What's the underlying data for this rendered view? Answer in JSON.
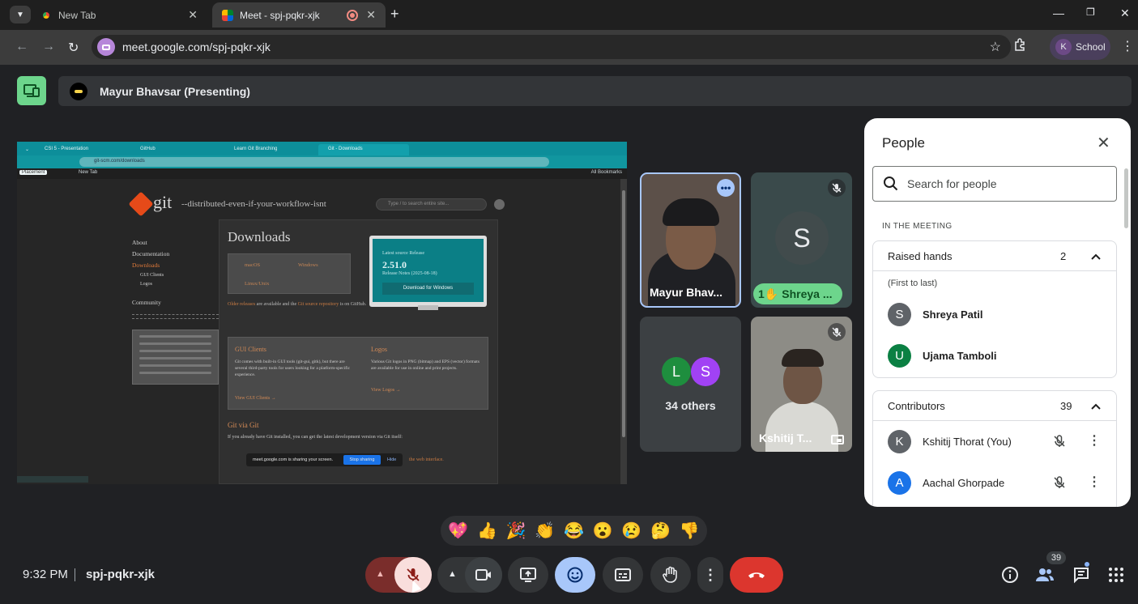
{
  "browser": {
    "tabs": [
      {
        "label": "New Tab",
        "active": false
      },
      {
        "label": "Meet - spj-pqkr-xjk",
        "active": true,
        "recording": true
      }
    ],
    "url": "meet.google.com/spj-pqkr-xjk",
    "profile": {
      "initial": "K",
      "label": "School"
    }
  },
  "meet": {
    "presenter_label": "Mayur Bhavsar (Presenting)",
    "time": "9:32 PM",
    "meeting_code": "spj-pqkr-xjk",
    "participant_count": "39",
    "colors": {
      "accent": "#a8c7fa",
      "end_call": "#dc362e",
      "hand_raise": "#6dd58c"
    }
  },
  "shared_screen": {
    "tabs": [
      "CSI 5 - Presentation",
      "GitHub",
      "Learn Git Branching",
      "Git - Downloads"
    ],
    "url": "git-scm.com/downloads",
    "bookmarks": {
      "first": "Placement",
      "new_tab": "New Tab",
      "all": "All Bookmarks"
    },
    "site": {
      "logo": "git",
      "tagline": "--distributed-even-if-your-workflow-isnt",
      "search_placeholder": "Type / to search entire site...",
      "nav": [
        "About",
        "Documentation",
        "Downloads",
        "GUI Clients",
        "Logos",
        "Community"
      ],
      "title": "Downloads",
      "os": [
        "macOS",
        "Windows",
        "Linux/Unix"
      ],
      "latest_label": "Latest source Release",
      "version": "2.51.0",
      "release_notes": "Release Notes (2025-08-18)",
      "download_button": "Download for Windows",
      "older_note_1": "Older releases",
      "older_note_2": " are available and the ",
      "older_note_3": "Git source repository",
      "older_note_4": " is on GitHub.",
      "gui_title": "GUI Clients",
      "gui_text": "Git comes with built-in GUI tools (git-gui, gitk), but there are several third-party tools for users looking for a platform-specific experience.",
      "gui_link": "View GUI Clients →",
      "logos_title": "Logos",
      "logos_text": "Various Git logos in PNG (bitmap) and EPS (vector) formats are available for use in online and print projects.",
      "logos_link": "View Logos →",
      "via_git_title": "Git via Git",
      "via_git_text": "If you already have Git installed, you can get the latest development version via Git itself:",
      "web_interface": "the web interface."
    },
    "share_bar": {
      "text": "meet.google.com is sharing your screen.",
      "stop": "Stop sharing",
      "hide": "Hide"
    }
  },
  "tiles": [
    {
      "name": "Mayur Bhav..."
    },
    {
      "name": "Shreya ...",
      "initial": "S",
      "hand_number": "1"
    },
    {
      "label": "34 others",
      "avatars": [
        {
          "initial": "L",
          "color": "#1e8e3e"
        },
        {
          "initial": "S",
          "color": "#a142f4"
        }
      ]
    },
    {
      "name": "Kshitij T..."
    }
  ],
  "people_panel": {
    "title": "People",
    "search_placeholder": "Search for people",
    "section_label": "IN THE MEETING",
    "raised_hands": {
      "label": "Raised hands",
      "count": "2",
      "order_note": "(First to last)",
      "people": [
        {
          "initial": "S",
          "name": "Shreya Patil",
          "color": "#5f6368"
        },
        {
          "initial": "U",
          "name": "Ujama Tamboli",
          "color": "#0b8043"
        }
      ]
    },
    "contributors": {
      "label": "Contributors",
      "count": "39",
      "people": [
        {
          "initial": "K",
          "name": "Kshitij Thorat (You)",
          "color": "#5f6368"
        },
        {
          "initial": "A",
          "name": "Aachal Ghorpade",
          "color": "#1a73e8"
        }
      ]
    }
  },
  "reactions": [
    "💖",
    "👍",
    "🎉",
    "👏",
    "😂",
    "😮",
    "😢",
    "🤔",
    "👎"
  ]
}
